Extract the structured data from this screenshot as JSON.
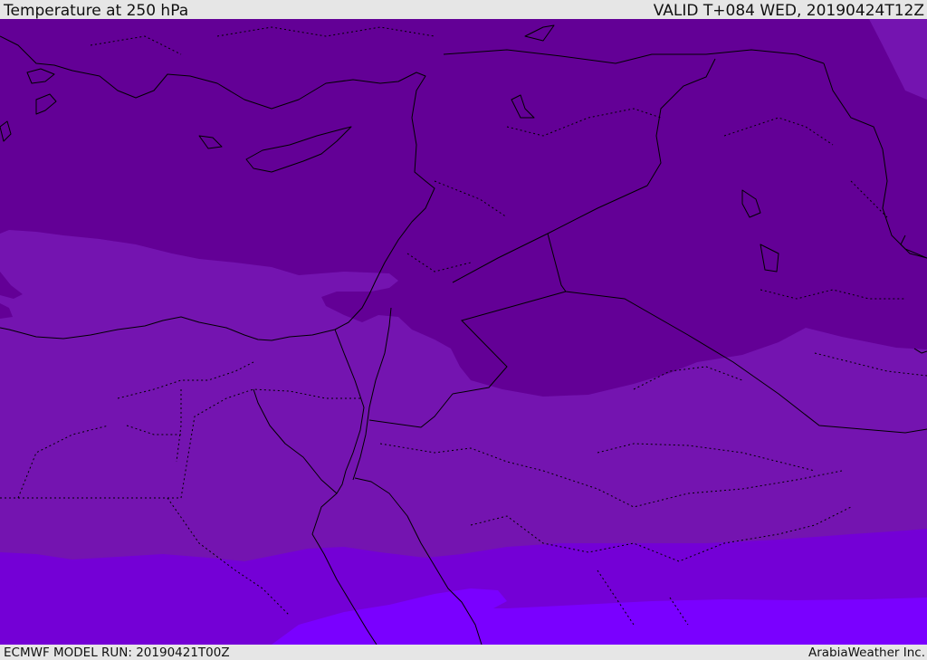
{
  "header": {
    "title": "Temperature at 250 hPa",
    "valid": "VALID T+084 WED, 20190424T12Z"
  },
  "footer": {
    "model_run": "ECMWF MODEL RUN: 20190421T00Z",
    "credit": "ArabiaWeather Inc."
  },
  "map": {
    "field": "temperature",
    "level": "250 hPa",
    "palette": {
      "coldest": "#630096",
      "cold": "#7414b0",
      "mid": "#7400d6",
      "warm": "#7a00ff",
      "coastline": "#000000",
      "border": "#000000"
    }
  }
}
